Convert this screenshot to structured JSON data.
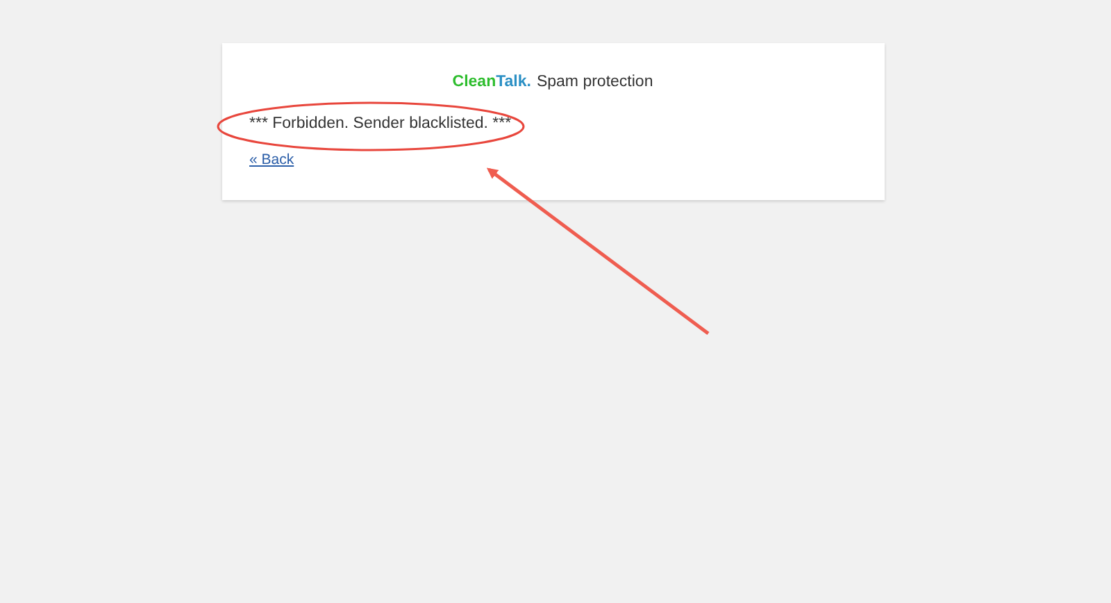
{
  "header": {
    "brand": [
      {
        "text": "Clean",
        "color": "#2dbd2d"
      },
      {
        "text": "Talk.",
        "color": "#2a8fc4"
      }
    ],
    "tagline": "Spam protection"
  },
  "message": "*** Forbidden. Sender blacklisted. ***",
  "back_link": "« Back"
}
